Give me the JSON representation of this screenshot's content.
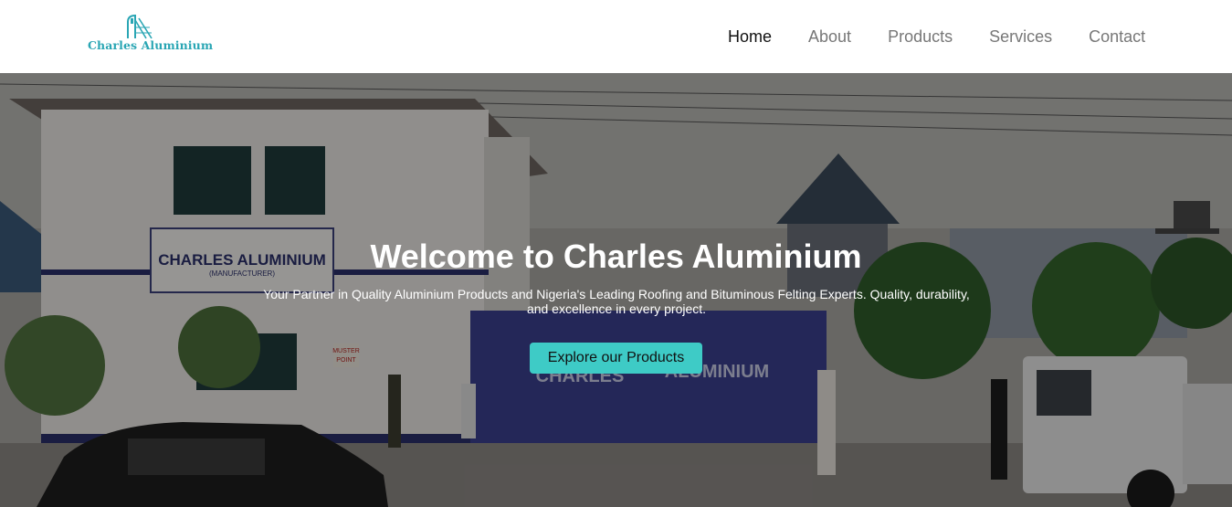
{
  "brand": {
    "name": "Charles Aluminium",
    "accent_color": "#2aa6b4",
    "logo_icon": "building-logo-icon"
  },
  "nav": {
    "items": [
      {
        "label": "Home",
        "active": true
      },
      {
        "label": "About",
        "active": false
      },
      {
        "label": "Products",
        "active": false
      },
      {
        "label": "Services",
        "active": false
      },
      {
        "label": "Contact",
        "active": false
      }
    ]
  },
  "hero": {
    "title": "Welcome to Charles Aluminium",
    "subtitle": "Your Partner in Quality Aluminium Products and Nigeria's Leading Roofing and Bituminous Felting Experts. Quality, durability, and excellence in every project.",
    "cta_label": "Explore our Products",
    "cta_color": "#3ecbc6",
    "background": {
      "building_sign": "CHARLES ALUMINIUM",
      "building_sign_sub": "(MANUFACTURER)",
      "gate_text_left": "CHARLES",
      "gate_text_right": "ALUMINIUM",
      "muster_sign": [
        "MUSTER",
        "POINT"
      ]
    }
  }
}
